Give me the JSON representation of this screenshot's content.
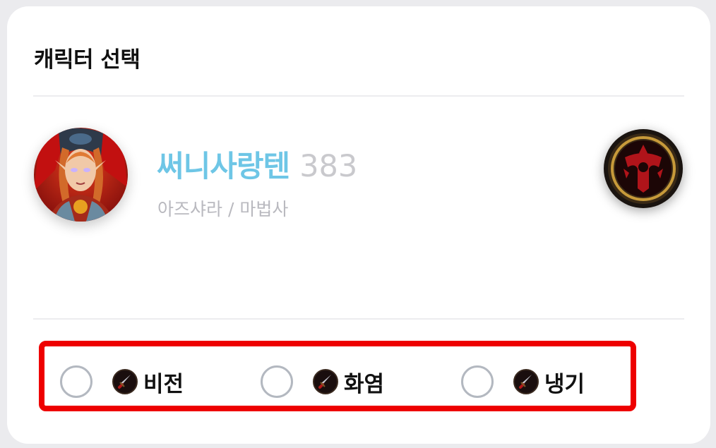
{
  "header": {
    "title": "캐릭터 선택"
  },
  "character": {
    "avatar_icon": "blood-elf-mage-portrait",
    "name": "써니사랑텐",
    "level": "383",
    "realm_class": "아즈샤라 / 마법사",
    "faction_icon": "horde-emblem",
    "name_color": "#6ec6e6"
  },
  "specs": {
    "highlight_color": "#ee0000",
    "options": [
      {
        "label": "비전",
        "icon": "dagger-icon",
        "selected": false
      },
      {
        "label": "화염",
        "icon": "dagger-icon",
        "selected": false
      },
      {
        "label": "냉기",
        "icon": "dagger-icon",
        "selected": false
      }
    ]
  }
}
